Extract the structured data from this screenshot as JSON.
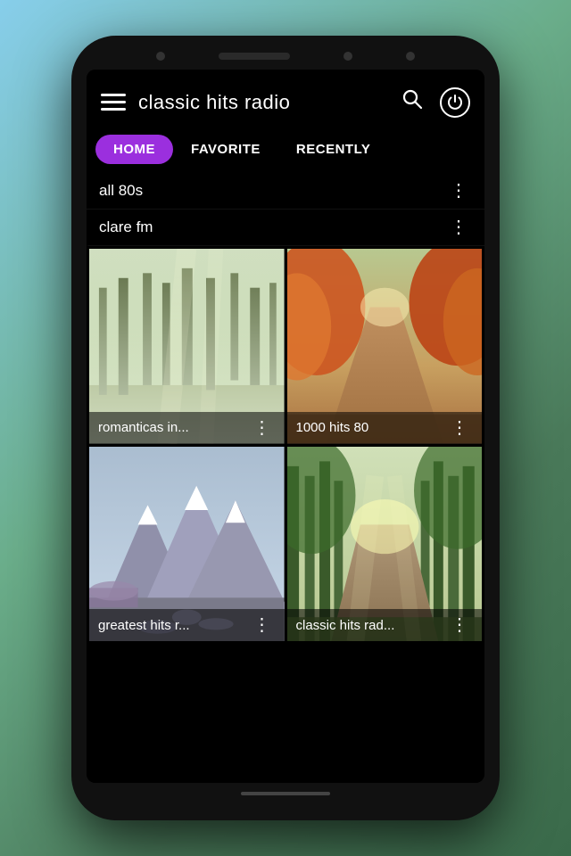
{
  "background": {
    "gradient": "linear-gradient(135deg, #87ceeb 0%, #6aad8a 40%, #4a7a5a 70%, #3a6a4a 100%)"
  },
  "header": {
    "title": "classic hits radio",
    "menu_label": "menu",
    "search_label": "search",
    "power_label": "power"
  },
  "tabs": [
    {
      "id": "home",
      "label": "HOME",
      "active": true
    },
    {
      "id": "favorite",
      "label": "FAVORITE",
      "active": false
    },
    {
      "id": "recently",
      "label": "RECENTLY",
      "active": false
    }
  ],
  "radio_rows": [
    {
      "name": "all 80s",
      "id": "all-80s"
    },
    {
      "name": "clare fm",
      "id": "clare-fm"
    }
  ],
  "grid_items": [
    {
      "id": "romanticas",
      "name": "romanticas in...",
      "image_type": "forest-misty",
      "colors": {
        "sky": "#c8d8b0",
        "trees": "#8aaa70",
        "ground": "#9aaa60",
        "fog": "#e0e8d0"
      }
    },
    {
      "id": "1000hits80",
      "name": "1000 hits 80",
      "image_type": "autumn-path",
      "colors": {
        "sky": "#c0a060",
        "trees": "#cc5520",
        "path": "#a06030",
        "foliage": "#dd6615"
      }
    },
    {
      "id": "greatesthits",
      "name": "greatest hits r...",
      "image_type": "mountain-snow",
      "colors": {
        "sky": "#b0c8d8",
        "mountain": "#d8e0e8",
        "snow": "#f0f4f8",
        "foreground": "#8888aa"
      }
    },
    {
      "id": "classichitsrad",
      "name": "classic hits rad...",
      "image_type": "forest-path",
      "colors": {
        "sky": "#c8d8b0",
        "trees": "#4a7a3a",
        "path": "#886644",
        "light": "#e0d8a0"
      }
    }
  ]
}
